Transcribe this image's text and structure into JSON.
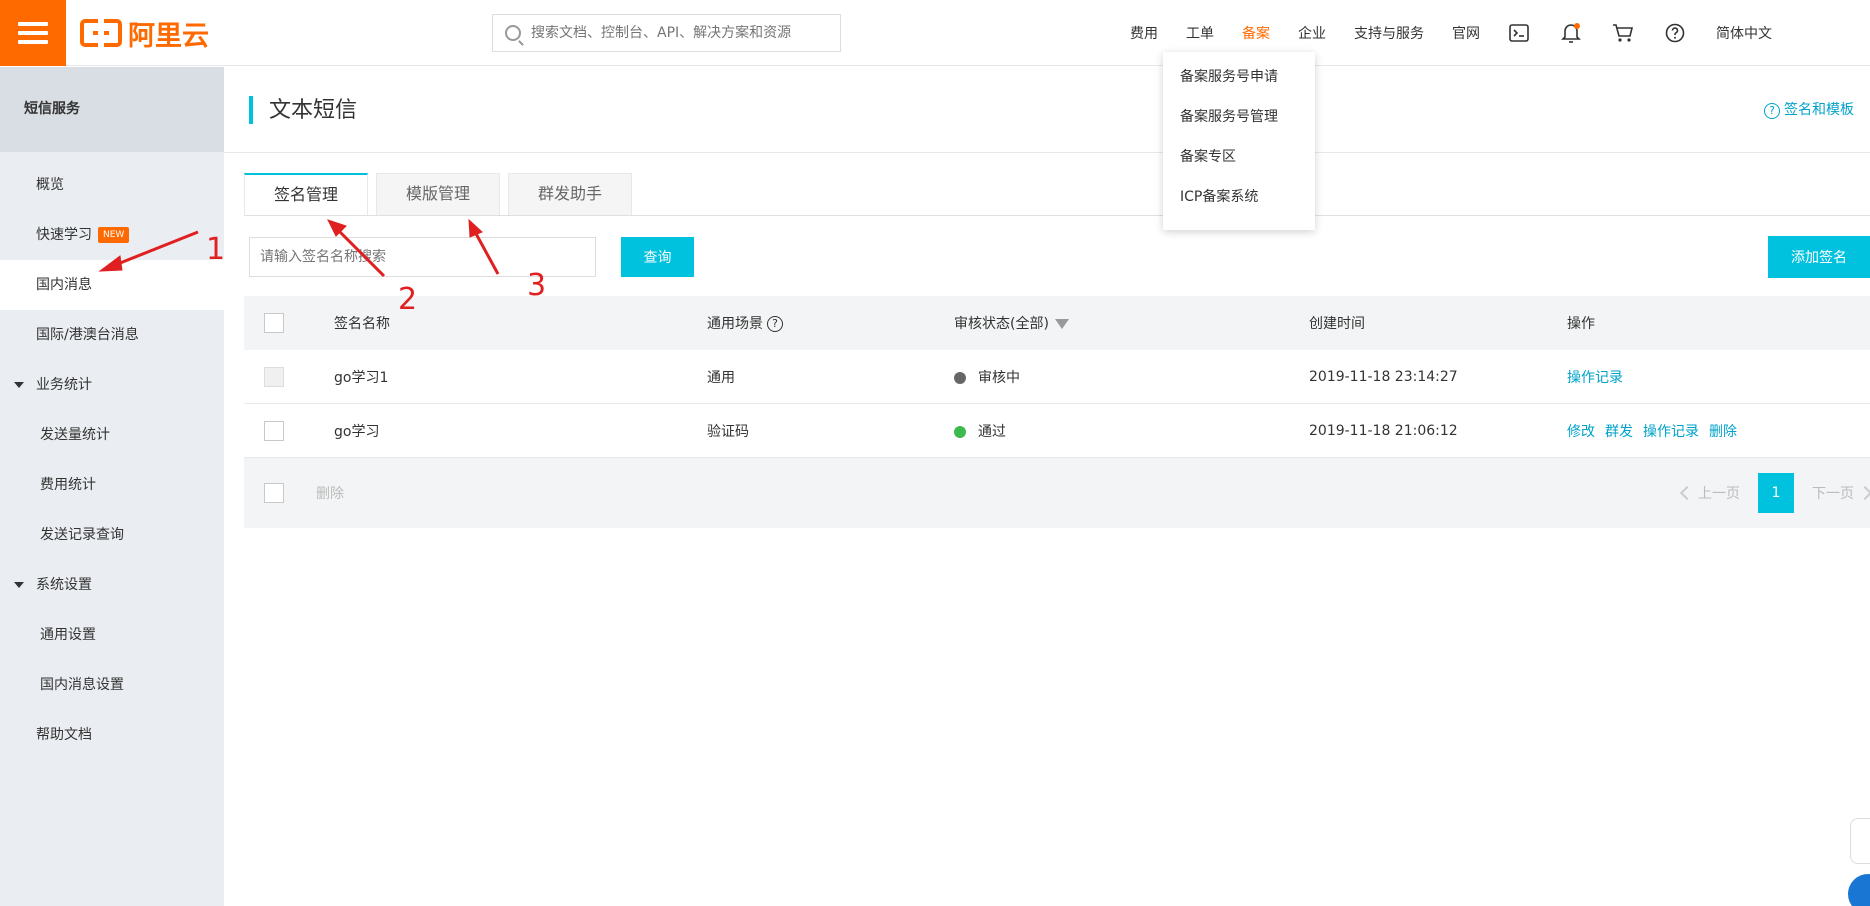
{
  "topbar": {
    "logo_text": "阿里云",
    "search_placeholder": "搜索文档、控制台、API、解决方案和资源",
    "nav": [
      "费用",
      "工单",
      "备案",
      "企业",
      "支持与服务",
      "官网"
    ],
    "active_nav": "备案",
    "lang": "简体中文",
    "icons": [
      "terminal-icon",
      "bell-icon",
      "cart-icon",
      "help-icon"
    ],
    "accent": "#ff6a00"
  },
  "dropdown": {
    "items": [
      "备案服务号申请",
      "备案服务号管理",
      "备案专区",
      "ICP备案系统"
    ]
  },
  "sidebar": {
    "title": "短信服务",
    "items": [
      {
        "label": "概览"
      },
      {
        "label": "快速学习",
        "badge": "NEW"
      },
      {
        "label": "国内消息"
      },
      {
        "label": "国际/港澳台消息"
      }
    ],
    "groups": [
      {
        "label": "业务统计",
        "items": [
          "发送量统计",
          "费用统计",
          "发送记录查询"
        ]
      },
      {
        "label": "系统设置",
        "items": [
          "通用设置",
          "国内消息设置"
        ]
      }
    ],
    "help": "帮助文档"
  },
  "main": {
    "title": "文本短信",
    "help_link": "签名和模板",
    "tabs": [
      "签名管理",
      "模版管理",
      "群发助手"
    ],
    "filter_placeholder": "请输入签名名称搜索",
    "query_button": "查询",
    "add_button": "添加签名",
    "columns": [
      "签名名称",
      "通用场景",
      "审核状态(全部)",
      "创建时间",
      "操作"
    ],
    "rows": [
      {
        "name": "go学习1",
        "scene": "通用",
        "status": "审核中",
        "status_color": "#666666",
        "time": "2019-11-18 23:14:27",
        "actions": [
          "操作记录"
        ]
      },
      {
        "name": "go学习",
        "scene": "验证码",
        "status": "通过",
        "status_color": "#3dba4e",
        "time": "2019-11-18 21:06:12",
        "actions": [
          "修改",
          "群发",
          "操作记录",
          "删除"
        ]
      }
    ],
    "footer": {
      "delete": "删除",
      "prev": "上一页",
      "page": "1",
      "next": "下一页"
    }
  },
  "annotations": [
    "1",
    "2",
    "3"
  ],
  "link_color": "#00a2ca",
  "primary_color": "#00c1de"
}
